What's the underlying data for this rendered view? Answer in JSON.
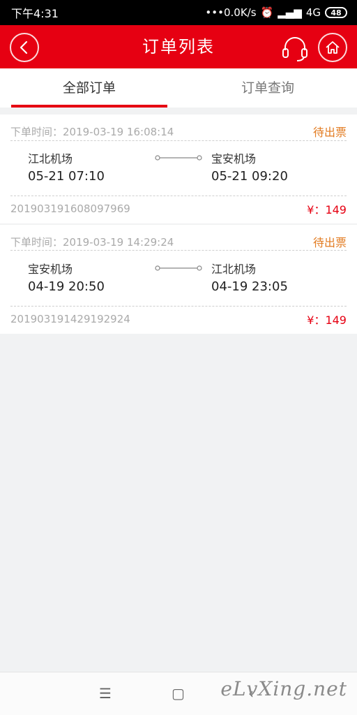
{
  "status_bar": {
    "time": "下午4:31",
    "net_speed": "•••0.0K/s",
    "signal": "4G",
    "battery": "48"
  },
  "app_bar": {
    "title": "订单列表",
    "back_icon": "chevron-left-icon",
    "service_icon": "headset-icon",
    "home_icon": "home-icon"
  },
  "tabs": [
    {
      "label": "全部订单",
      "active": true
    },
    {
      "label": "订单查询",
      "active": false
    }
  ],
  "orders": [
    {
      "order_time": "下单时间：2019-03-19 16:08:14",
      "status": "待出票",
      "from_city": "江北机场",
      "from_time": "05-21 07:10",
      "to_city": "宝安机场",
      "to_time": "05-21 09:20",
      "order_no": "201903191608097969",
      "price": "¥：149"
    },
    {
      "order_time": "下单时间：2019-03-19 14:29:24",
      "status": "待出票",
      "from_city": "宝安机场",
      "from_time": "04-19 20:50",
      "to_city": "江北机场",
      "to_time": "04-19 23:05",
      "order_no": "201903191429192924",
      "price": "¥：149"
    }
  ],
  "nav_bar": {
    "menu_icon": "☰",
    "home_icon": "▢",
    "back_icon": "‹"
  },
  "watermark": "eLvXing.net",
  "colors": {
    "brand_red": "#e60012",
    "status_orange": "#e27a1f"
  }
}
